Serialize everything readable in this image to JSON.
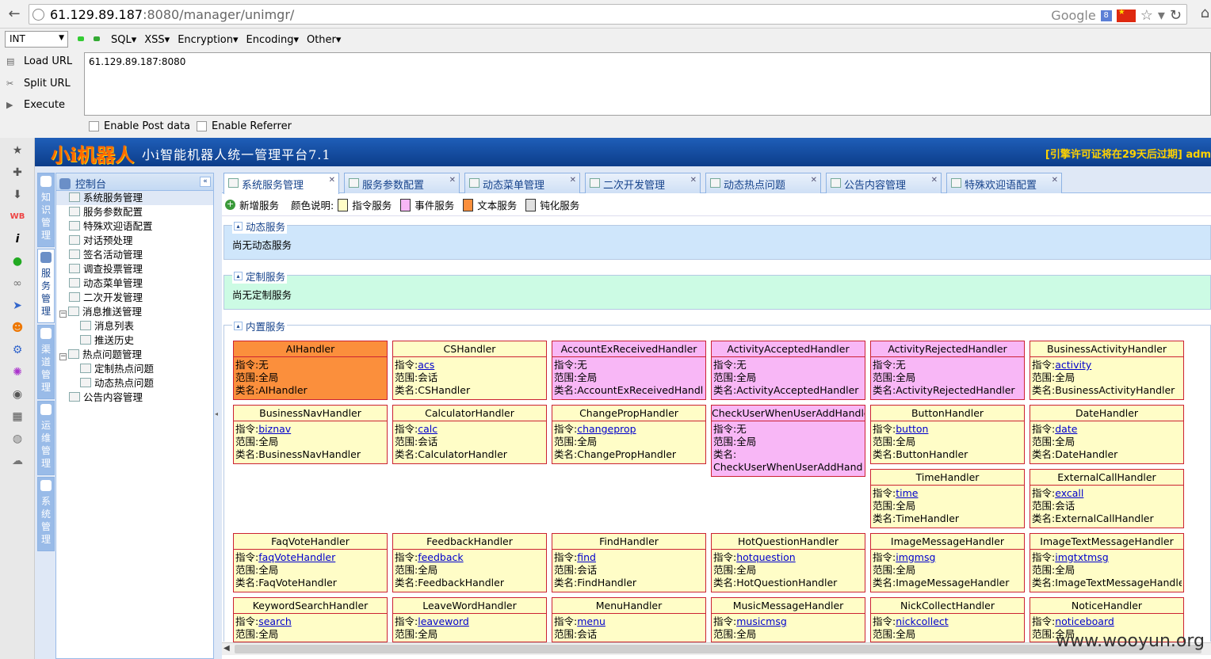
{
  "browser": {
    "url_host": "61.129.89.187",
    "url_rest": ":8080/manager/unimgr/",
    "search_engine": "Google"
  },
  "hackbar": {
    "select_value": "INT",
    "menus": [
      "SQL▾",
      "XSS▾",
      "Encryption▾",
      "Encoding▾",
      "Other▾"
    ],
    "load_url": "Load URL",
    "split_url": "Split URL",
    "execute": "Execute",
    "url_value": "61.129.89.187:8080",
    "enable_post": "Enable Post data",
    "enable_referrer": "Enable Referrer"
  },
  "app": {
    "logo": "小i机器人",
    "title": "小i智能机器人统一管理平台7.1",
    "license": "[引擎许可证将在29天后过期] adm",
    "modules": [
      "知识管理",
      "服务管理",
      "渠道管理",
      "运维管理",
      "系统管理"
    ],
    "tree_title": "控制台",
    "tree": [
      {
        "label": "系统服务管理",
        "indent": 0,
        "exp": ""
      },
      {
        "label": "服务参数配置",
        "indent": 0,
        "exp": ""
      },
      {
        "label": "特殊欢迎语配置",
        "indent": 0,
        "exp": ""
      },
      {
        "label": "对话预处理",
        "indent": 0,
        "exp": ""
      },
      {
        "label": "签名活动管理",
        "indent": 0,
        "exp": ""
      },
      {
        "label": "调查投票管理",
        "indent": 0,
        "exp": ""
      },
      {
        "label": "动态菜单管理",
        "indent": 0,
        "exp": ""
      },
      {
        "label": "二次开发管理",
        "indent": 0,
        "exp": ""
      },
      {
        "label": "消息推送管理",
        "indent": 0,
        "exp": "−"
      },
      {
        "label": "消息列表",
        "indent": 1,
        "exp": ""
      },
      {
        "label": "推送历史",
        "indent": 1,
        "exp": ""
      },
      {
        "label": "热点问题管理",
        "indent": 0,
        "exp": "−"
      },
      {
        "label": "定制热点问题",
        "indent": 1,
        "exp": ""
      },
      {
        "label": "动态热点问题",
        "indent": 1,
        "exp": ""
      },
      {
        "label": "公告内容管理",
        "indent": 0,
        "exp": ""
      }
    ],
    "tabs": [
      "系统服务管理",
      "服务参数配置",
      "动态菜单管理",
      "二次开发管理",
      "动态热点问题",
      "公告内容管理",
      "特殊欢迎语配置"
    ],
    "add_service": "新增服务",
    "color_legend_label": "颜色说明:",
    "legend": [
      {
        "label": "指令服务",
        "color": "#fffdc7"
      },
      {
        "label": "事件服务",
        "color": "#f8b7f6"
      },
      {
        "label": "文本服务",
        "color": "#fb8f3c"
      },
      {
        "label": "钝化服务",
        "color": "#e0e0e0"
      }
    ],
    "dynamic_title": "动态服务",
    "dynamic_empty": "尚无动态服务",
    "custom_title": "定制服务",
    "custom_empty": "尚无定制服务",
    "builtin_title": "内置服务",
    "field_cmd": "指令:",
    "field_scope": "范围:",
    "field_class": "类名:",
    "cards": [
      {
        "name": "AIHandler",
        "cmd": "无",
        "link": false,
        "scope": "全局",
        "cls": "AIHandler",
        "type": "text"
      },
      {
        "name": "CSHandler",
        "cmd": "acs",
        "link": true,
        "scope": "会话",
        "cls": "CSHandler",
        "type": "cmd"
      },
      {
        "name": "AccountExReceivedHandler",
        "cmd": "无",
        "link": false,
        "scope": "全局",
        "cls": "AccountExReceivedHandler",
        "type": "event"
      },
      {
        "name": "ActivityAcceptedHandler",
        "cmd": "无",
        "link": false,
        "scope": "全局",
        "cls": "ActivityAcceptedHandler",
        "type": "event"
      },
      {
        "name": "ActivityRejectedHandler",
        "cmd": "无",
        "link": false,
        "scope": "全局",
        "cls": "ActivityRejectedHandler",
        "type": "event"
      },
      {
        "name": "BusinessActivityHandler",
        "cmd": "activity",
        "link": true,
        "scope": "全局",
        "cls": "BusinessActivityHandler",
        "type": "cmd"
      },
      {
        "name": "BusinessNavHandler",
        "cmd": "biznav",
        "link": true,
        "scope": "全局",
        "cls": "BusinessNavHandler",
        "type": "cmd"
      },
      {
        "name": "CalculatorHandler",
        "cmd": "calc",
        "link": true,
        "scope": "会话",
        "cls": "CalculatorHandler",
        "type": "cmd"
      },
      {
        "name": "ChangePropHandler",
        "cmd": "changeprop",
        "link": true,
        "scope": "全局",
        "cls": "ChangePropHandler",
        "type": "cmd"
      },
      {
        "name": "CheckUserWhenUserAddHandler",
        "cmd": "无",
        "link": false,
        "scope": "全局",
        "cls": "CheckUserWhenUserAddHandler",
        "type": "event"
      },
      {
        "name": "ButtonHandler",
        "cmd": "button",
        "link": true,
        "scope": "全局",
        "cls": "ButtonHandler",
        "type": "cmd"
      },
      {
        "name": "DateHandler",
        "cmd": "date",
        "link": true,
        "scope": "全局",
        "cls": "DateHandler",
        "type": "cmd"
      },
      {
        "name": "TimeHandler",
        "cmd": "time",
        "link": true,
        "scope": "全局",
        "cls": "TimeHandler",
        "type": "cmd"
      },
      {
        "name": "ExternalCallHandler",
        "cmd": "excall",
        "link": true,
        "scope": "会话",
        "cls": "ExternalCallHandler",
        "type": "cmd"
      },
      {
        "name": "FaqVoteHandler",
        "cmd": "faqVoteHandler",
        "link": true,
        "scope": "全局",
        "cls": "FaqVoteHandler",
        "type": "cmd"
      },
      {
        "name": "FeedbackHandler",
        "cmd": "feedback",
        "link": true,
        "scope": "全局",
        "cls": "FeedbackHandler",
        "type": "cmd"
      },
      {
        "name": "FindHandler",
        "cmd": "find",
        "link": true,
        "scope": "会话",
        "cls": "FindHandler",
        "type": "cmd"
      },
      {
        "name": "HotQuestionHandler",
        "cmd": "hotquestion",
        "link": true,
        "scope": "全局",
        "cls": "HotQuestionHandler",
        "type": "cmd"
      },
      {
        "name": "ImageMessageHandler",
        "cmd": "imgmsg",
        "link": true,
        "scope": "全局",
        "cls": "ImageMessageHandler",
        "type": "cmd"
      },
      {
        "name": "ImageTextMessageHandler",
        "cmd": "imgtxtmsg",
        "link": true,
        "scope": "全局",
        "cls": "ImageTextMessageHandler",
        "type": "cmd"
      },
      {
        "name": "KeywordSearchHandler",
        "cmd": "search",
        "link": true,
        "scope": "全局",
        "cls": "",
        "type": "cmd"
      },
      {
        "name": "LeaveWordHandler",
        "cmd": "leaveword",
        "link": true,
        "scope": "全局",
        "cls": "",
        "type": "cmd"
      },
      {
        "name": "MenuHandler",
        "cmd": "menu",
        "link": true,
        "scope": "会话",
        "cls": "",
        "type": "cmd"
      },
      {
        "name": "MusicMessageHandler",
        "cmd": "musicmsg",
        "link": true,
        "scope": "全局",
        "cls": "",
        "type": "cmd"
      },
      {
        "name": "NickCollectHandler",
        "cmd": "nickcollect",
        "link": true,
        "scope": "全局",
        "cls": "",
        "type": "cmd"
      },
      {
        "name": "NoticeHandler",
        "cmd": "noticeboard",
        "link": true,
        "scope": "全局",
        "cls": "",
        "type": "cmd"
      }
    ]
  },
  "watermark": "www.wooyun.org"
}
